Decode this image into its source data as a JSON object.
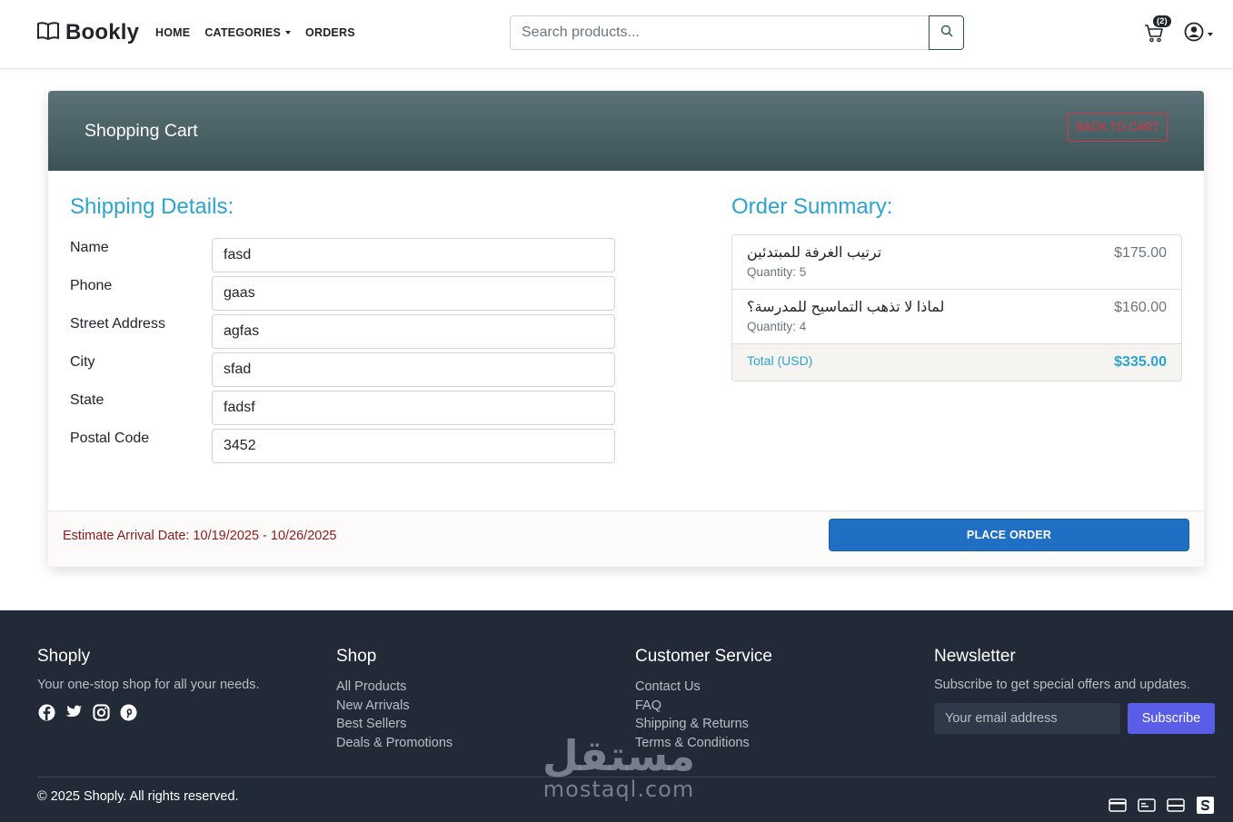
{
  "navbar": {
    "brand": "Bookly",
    "links": {
      "home": "HOME",
      "categories": "CATEGORIES",
      "orders": "ORDERS"
    },
    "search_placeholder": "Search products...",
    "cart_count": "(2)"
  },
  "cart": {
    "header_title": "Shopping Cart",
    "back_button": "BACK TO CART",
    "shipping_title": "Shipping Details:",
    "fields": [
      {
        "label": "Name",
        "value": "fasd"
      },
      {
        "label": "Phone",
        "value": "gaas"
      },
      {
        "label": "Street Address",
        "value": "agfas"
      },
      {
        "label": "City",
        "value": "sfad"
      },
      {
        "label": "State",
        "value": "fadsf"
      },
      {
        "label": "Postal Code",
        "value": "3452"
      }
    ],
    "summary_title": "Order Summary:",
    "items": [
      {
        "name": "ترتيب الغرفة للمبتدئين",
        "quantity": "Quantity: 5",
        "price": "$175.00"
      },
      {
        "name": "لماذا لا تذهب التماسيح للمدرسة؟",
        "quantity": "Quantity: 4",
        "price": "$160.00"
      }
    ],
    "total_label": "Total (USD)",
    "total_value": "$335.00",
    "arrival": "Estimate Arrival Date: 10/19/2025 - 10/26/2025",
    "place_order": "PLACE ORDER"
  },
  "footer": {
    "about": {
      "title": "Shoply",
      "text": "Your one-stop shop for all your needs."
    },
    "shop": {
      "title": "Shop",
      "links": [
        "All Products",
        "New Arrivals",
        "Best Sellers",
        "Deals & Promotions"
      ]
    },
    "service": {
      "title": "Customer Service",
      "links": [
        "Contact Us",
        "FAQ",
        "Shipping & Returns",
        "Terms & Conditions"
      ]
    },
    "newsletter": {
      "title": "Newsletter",
      "text": "Subscribe to get special offers and updates.",
      "placeholder": "Your email address",
      "button": "Subscribe"
    },
    "copyright": "© 2025 Shoply. All rights reserved."
  },
  "watermark": {
    "arabic": "مستقل",
    "latin": "mostaql.com"
  },
  "colors": {
    "accent": "#2aa4d0",
    "primary_button": "#1f6fc4",
    "danger": "#dc3545",
    "footer_bg": "#212a36",
    "subscribe": "#5a5de8"
  }
}
